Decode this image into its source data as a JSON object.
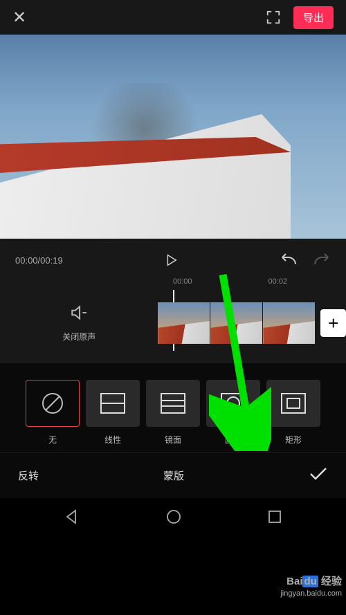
{
  "header": {
    "export_label": "导出"
  },
  "playback": {
    "current_time": "00:00",
    "total_time": "00:19",
    "time_display": "00:00/00:19"
  },
  "timeline": {
    "ruler": [
      "00:00",
      "00:02"
    ],
    "mute_label": "关闭原声"
  },
  "mask_options": [
    {
      "name": "none",
      "label": "无",
      "selected": true
    },
    {
      "name": "linear",
      "label": "线性",
      "selected": false
    },
    {
      "name": "mirror",
      "label": "镜面",
      "selected": false
    },
    {
      "name": "circle",
      "label": "圆形",
      "selected": false
    },
    {
      "name": "rect",
      "label": "矩形",
      "selected": false
    }
  ],
  "bottom": {
    "flip_label": "反转",
    "panel_title": "蒙版"
  },
  "watermark": {
    "brand_prefix": "Bai",
    "brand_mid": "du",
    "brand_suffix": "经验",
    "url": "jingyan.baidu.com"
  }
}
